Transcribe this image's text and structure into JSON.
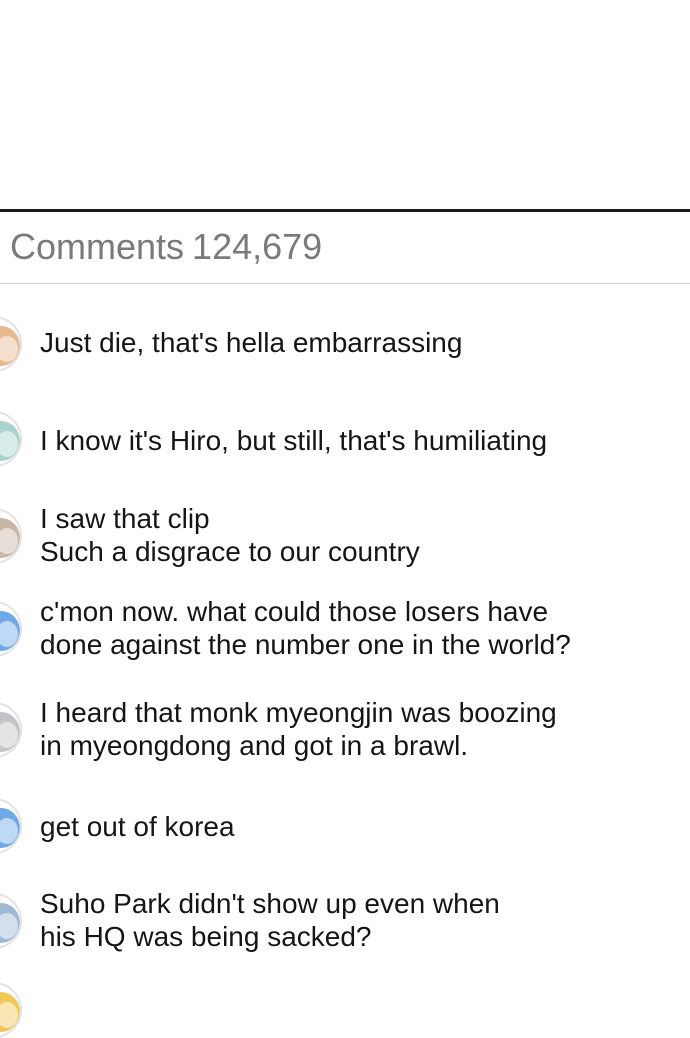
{
  "header": {
    "label": "Comments",
    "count": "124,679"
  },
  "comments": [
    {
      "avatar": "user-avatar-icon",
      "color": "#e6b98f",
      "lines": [
        "Just die, that's hella embarrassing"
      ]
    },
    {
      "avatar": "user-avatar-icon",
      "color": "#a9d4ce",
      "lines": [
        "I know it's Hiro, but still, that's humiliating"
      ]
    },
    {
      "avatar": "user-avatar-icon",
      "color": "#c8b6a6",
      "lines": [
        "I saw that clip",
        "Such a disgrace to our country"
      ]
    },
    {
      "avatar": "user-avatar-icon",
      "color": "#6fa9e8",
      "lines": [
        "c'mon now. what could those losers have",
        "done against the number one in the world?"
      ]
    },
    {
      "avatar": "user-avatar-icon",
      "color": "#c4c4c8",
      "lines": [
        "I heard that monk myeongjin was boozing",
        "in myeongdong and got in a brawl."
      ]
    },
    {
      "avatar": "user-avatar-icon",
      "color": "#6fa9e8",
      "lines": [
        "get out of korea"
      ]
    },
    {
      "avatar": "user-avatar-icon",
      "color": "#9fb8d6",
      "lines": [
        "Suho Park didn't show up even when",
        "his HQ was being sacked?"
      ]
    },
    {
      "avatar": "user-avatar-icon",
      "color": "#f0c85a",
      "lines": []
    }
  ]
}
